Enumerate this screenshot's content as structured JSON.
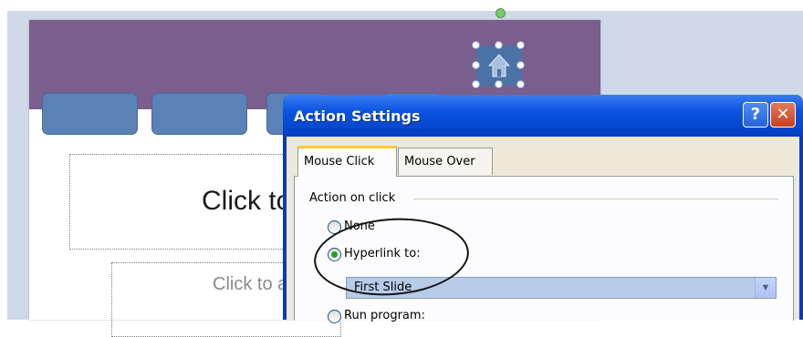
{
  "slide": {
    "title_placeholder": "Click to add title",
    "subtitle_placeholder": "Click to add subtitle",
    "home_icon": "home-icon",
    "banner_color": "#7a5e8d",
    "nav_button_color": "#5b82b6"
  },
  "dialog": {
    "title": "Action Settings",
    "help_label": "?",
    "close_label": "✕",
    "tabs": [
      {
        "label": "Mouse Click",
        "active": true
      },
      {
        "label": "Mouse Over",
        "active": false
      }
    ],
    "group_label": "Action on click",
    "options": {
      "none": "None",
      "hyperlink": "Hyperlink to:",
      "run_program": "Run program:"
    },
    "selected_option": "hyperlink",
    "hyperlink_value": "First Slide",
    "titlebar_color": "#0a53e0"
  }
}
